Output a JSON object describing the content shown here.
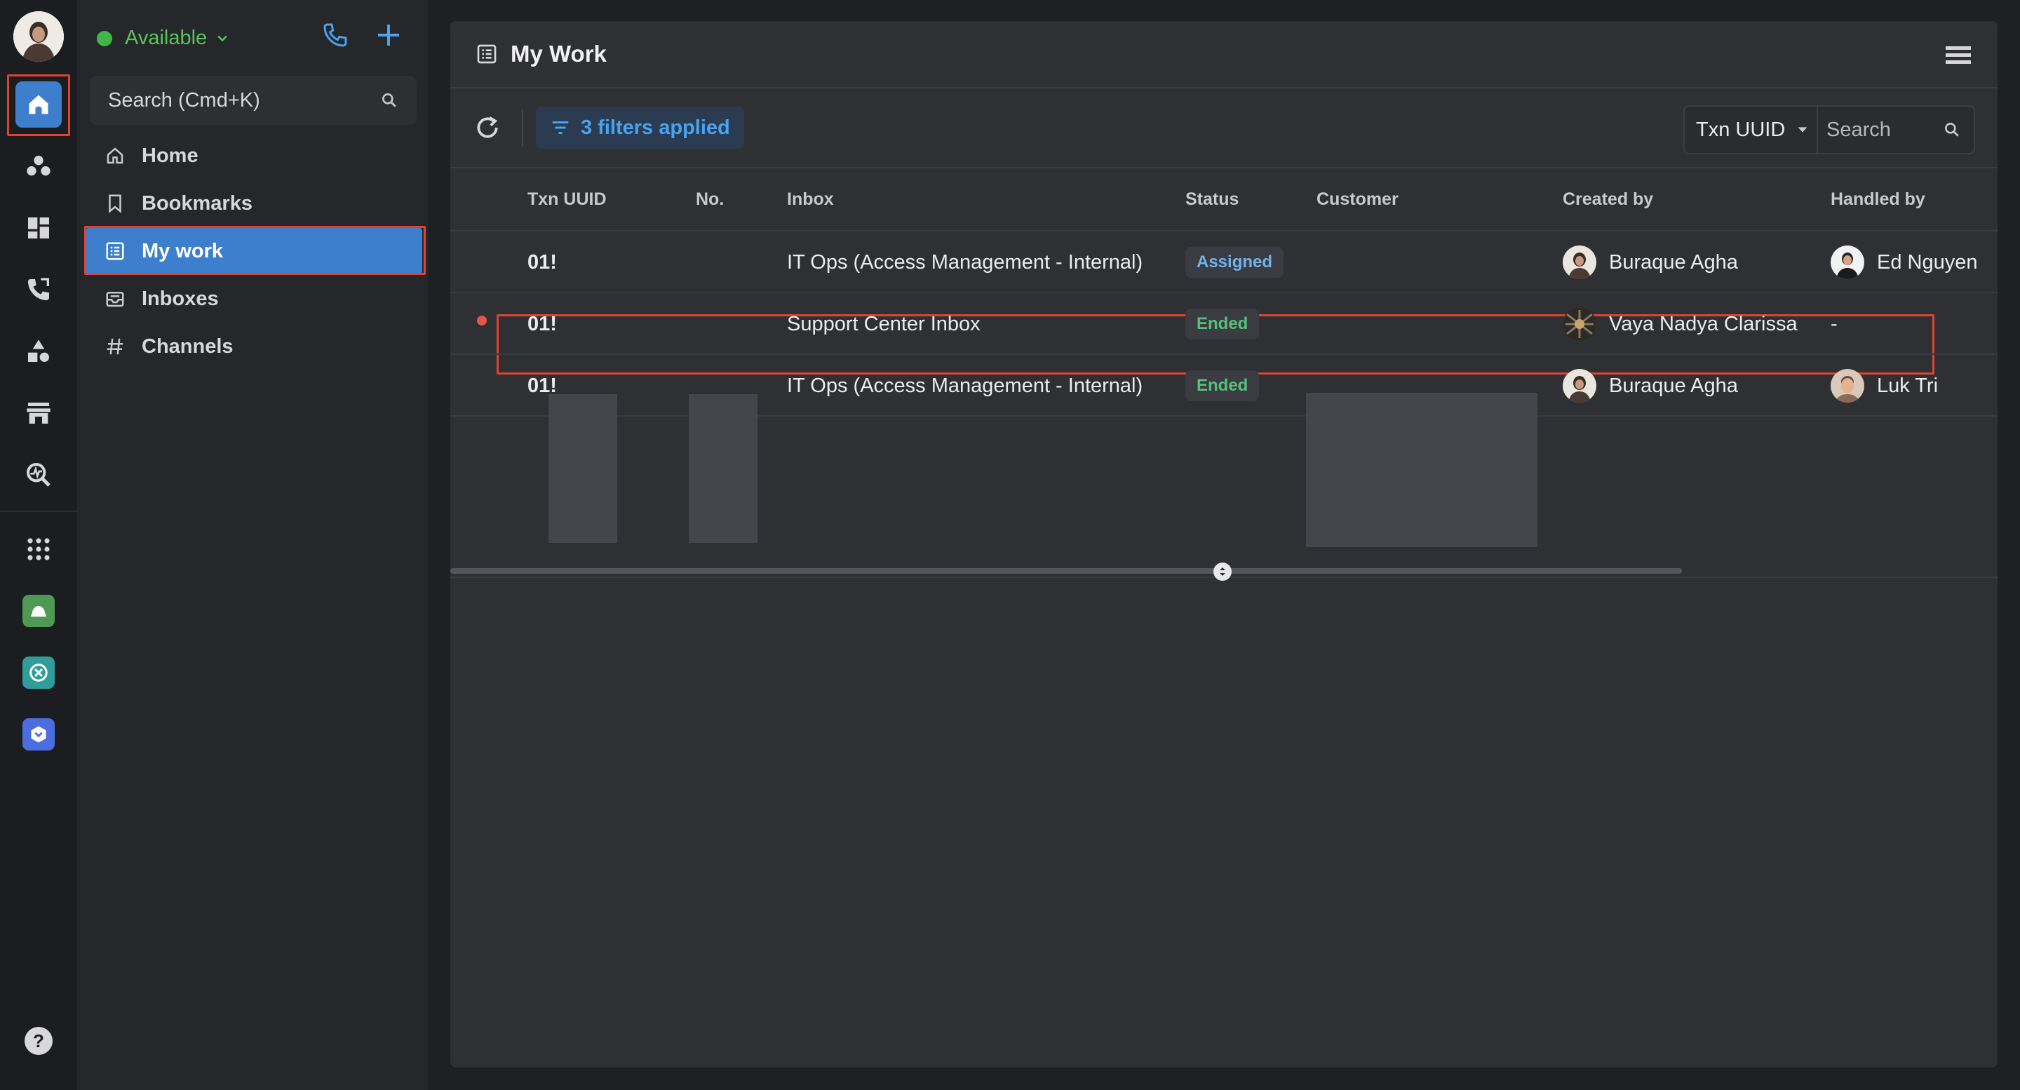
{
  "rail": {
    "icons": [
      "home-icon",
      "contacts-icon",
      "dashboard-icon",
      "calls-icon",
      "shapes-icon",
      "store-icon",
      "analytics-icon",
      "apps-grid-icon",
      "green-app-icon",
      "teal-app-icon",
      "blue-app-icon"
    ],
    "help": "?"
  },
  "sidebar": {
    "status": "Available",
    "search_placeholder": "Search (Cmd+K)",
    "nav": [
      {
        "label": "Home",
        "icon": "home-outline-icon"
      },
      {
        "label": "Bookmarks",
        "icon": "bookmark-icon"
      },
      {
        "label": "My work",
        "icon": "list-icon",
        "active": true
      },
      {
        "label": "Inboxes",
        "icon": "inbox-icon"
      },
      {
        "label": "Channels",
        "icon": "hash-icon"
      }
    ]
  },
  "main": {
    "title": "My Work",
    "filters_label": "3 filters applied",
    "search_field": "Txn UUID",
    "search_placeholder": "Search",
    "columns": [
      "Txn UUID",
      "No.",
      "Inbox",
      "Status",
      "Customer",
      "Created by",
      "Handled by"
    ],
    "rows": [
      {
        "uuid": "01!",
        "inbox": "IT Ops (Access Management - Internal)",
        "status": "Assigned",
        "created_by": "Buraque Agha",
        "handled_by": "Ed Nguyen",
        "unread": false
      },
      {
        "uuid": "01!",
        "inbox": "Support Center Inbox",
        "status": "Ended",
        "created_by": "Vaya Nadya Clarissa",
        "handled_by": "-",
        "unread": true
      },
      {
        "uuid": "01!",
        "inbox": "IT Ops (Access Management - Internal)",
        "status": "Ended",
        "created_by": "Buraque Agha",
        "handled_by": "Luk Tri",
        "unread": false
      }
    ]
  },
  "colors": {
    "accent": "#3d7fcc",
    "available": "#58c65a",
    "assigned": "#6fb3ee",
    "ended": "#55c27a",
    "highlight": "#e0432f"
  }
}
